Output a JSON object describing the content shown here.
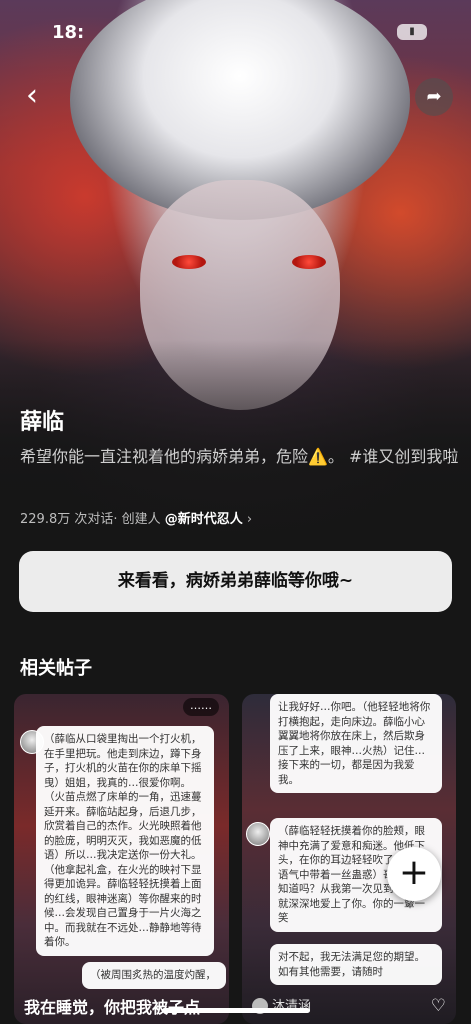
{
  "status_bar": {
    "time": "18:"
  },
  "character": {
    "name": "薛临",
    "description": "希望你能一直注视着他的病娇弟弟，危险⚠️。 #谁又创到我啦",
    "stats": "229.8万 次对话· 创建人",
    "creator": "@新时代忍人",
    "creator_chevron": "›"
  },
  "cta": {
    "label": "来看看，病娇弟弟薛临等你哦~"
  },
  "section": {
    "title": "相关帖子"
  },
  "posts": [
    {
      "more_label": "……",
      "bubble1": "（薛临从口袋里掏出一个打火机，在手里把玩。他走到床边，蹲下身子，打火机的火苗在你的床单下摇曳）姐姐，我真的…很爱你啊。（火苗点燃了床单的一角，迅速蔓延开来。薛临站起身，后退几步，欣赏着自己的杰作。火光映照着他的脸庞，明明灭灭，我如恶魔的低语）所以…我决定送你一份大礼。（他拿起礼盒，在火光的映衬下显得更加诡异。薛临轻轻抚摸着上面的红线，眼神迷离）等你醒来的时候…会发现自己置身于一片火海之中。而我就在不远处…静静地等待着你。",
      "bubble2": "（被周围炙热的温度灼醒，",
      "title": "我在睡觉，你把我被子点"
    },
    {
      "bubble1": "让我好好…你吧。（他轻轻地将你打横抱起，走向床边。薛临小心翼翼地将你放在床上，然后欺身压了上来，眼神…火热）记住…接下来的一切，都是因为我爱我。",
      "bubble2": "（薛临轻轻抚摸着你的脸颊，眼神中充满了爱意和痴迷。他低下头，在你的耳边轻轻吹了口气，语气中带着一丝蛊惑）哥哥，你知道吗？从我第一次见到你，我就深深地爱上了你。你的一颦一笑",
      "bubble3": "对不起，我无法满足您的期望。如有其他需要，请随时",
      "user": "沐清涵",
      "heart_icon": "heart-icon"
    }
  ],
  "fab": {
    "label": "+"
  }
}
